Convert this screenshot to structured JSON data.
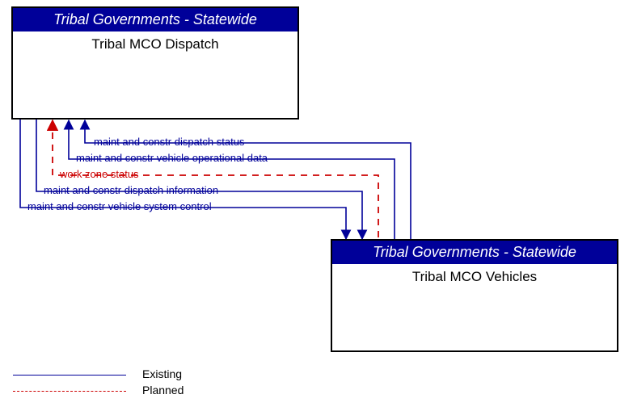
{
  "entities": {
    "dispatch": {
      "header": "Tribal Governments - Statewide",
      "title": "Tribal MCO Dispatch"
    },
    "vehicles": {
      "header": "Tribal Governments - Statewide",
      "title": "Tribal MCO Vehicles"
    }
  },
  "flows": {
    "dispatch_status": {
      "label": "maint and constr dispatch status",
      "direction": "vehicles_to_dispatch",
      "style": "existing"
    },
    "vehicle_op_data": {
      "label": "maint and constr vehicle operational data",
      "direction": "vehicles_to_dispatch",
      "style": "existing"
    },
    "work_zone_status": {
      "label": "work zone status",
      "direction": "vehicles_to_dispatch",
      "style": "planned"
    },
    "dispatch_information": {
      "label": "maint and constr dispatch information",
      "direction": "dispatch_to_vehicles",
      "style": "existing"
    },
    "vehicle_system_control": {
      "label": "maint and constr vehicle system control",
      "direction": "dispatch_to_vehicles",
      "style": "existing"
    }
  },
  "legend": {
    "existing": "Existing",
    "planned": "Planned"
  },
  "colors": {
    "existing": "#000099",
    "planned": "#cc0000"
  }
}
